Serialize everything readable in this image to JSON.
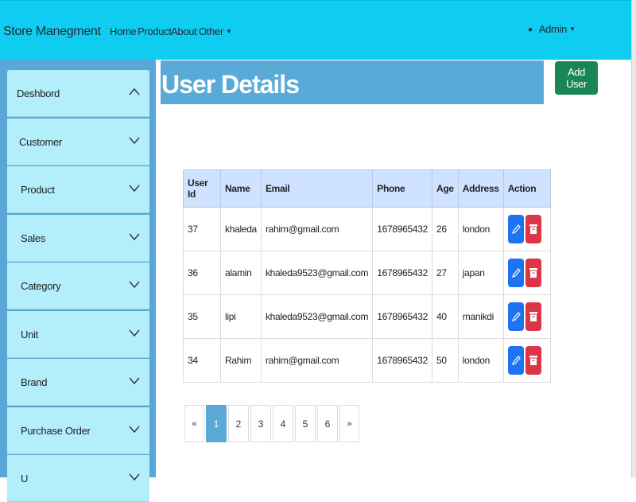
{
  "navbar": {
    "brand": "Store Manegment",
    "links": [
      "Home",
      "Product",
      "About",
      "Other"
    ],
    "user": "Admin"
  },
  "sidebar": {
    "items": [
      {
        "label": "Deshbord",
        "icon": "chevron-up-icon"
      },
      {
        "label": "Customer",
        "icon": "chevron-down-icon"
      },
      {
        "label": "Product",
        "icon": "chevron-down-icon"
      },
      {
        "label": "Sales",
        "icon": "chevron-down-icon"
      },
      {
        "label": "Category",
        "icon": "chevron-down-icon"
      },
      {
        "label": "Unit",
        "icon": "chevron-down-icon"
      },
      {
        "label": "Brand",
        "icon": "chevron-down-icon"
      },
      {
        "label": "Purchase Order",
        "icon": "chevron-down-icon"
      },
      {
        "label": "U",
        "icon": "chevron-down-icon"
      }
    ]
  },
  "main": {
    "title": "User Details",
    "add_button": "Add User",
    "table": {
      "headers": [
        "User Id",
        "Name",
        "Email",
        "Phone",
        "Age",
        "Address",
        "Action"
      ],
      "rows": [
        [
          "37",
          "khaleda",
          "rahim@gmail.com",
          "1678965432",
          "26",
          "london"
        ],
        [
          "36",
          "alamin",
          "khaleda9523@gmail.com",
          "1678965432",
          "27",
          "japan"
        ],
        [
          "35",
          "lipi",
          "khaleda9523@gmail.com",
          "1678965432",
          "40",
          "manikdi"
        ],
        [
          "34",
          "Rahim",
          "rahim@gmail.com",
          "1678965432",
          "50",
          "london"
        ]
      ]
    },
    "pagination": {
      "prev": "«",
      "pages": [
        "1",
        "2",
        "3",
        "4",
        "5",
        "6"
      ],
      "next": "»",
      "active": "1"
    }
  },
  "colors": {
    "navbar": "#0fcdf1",
    "sidebar": "#5ba6d9",
    "sidebar_item": "#b2effa",
    "title_bar": "#5aaad8",
    "add_button": "#198754",
    "edit_button": "#1e73f0",
    "delete_button": "#dc3545",
    "table_header": "#cfe2ff"
  }
}
